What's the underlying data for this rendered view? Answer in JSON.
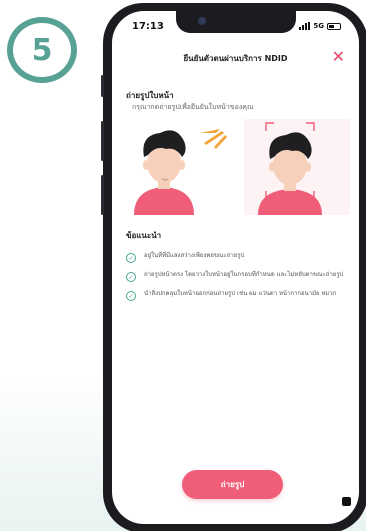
{
  "step": {
    "number": "5",
    "color": "#58a195"
  },
  "status_bar": {
    "time": "17:13",
    "network": "5G"
  },
  "header": {
    "title": "ยืนยันตัวตนผ่านบริการ NDID",
    "close_icon": "close-icon"
  },
  "photo_section": {
    "title": "ถ่ายรูปใบหน้า",
    "subtitle": "กรุณากดถ่ายรูปเพื่อยืนยันใบหน้าของคุณ"
  },
  "tips": {
    "title": "ข้อแนะนำ",
    "items": [
      "อยู่ในที่ที่มีแสงสว่างเพียงพอขณะถ่ายรูป",
      "ถ่ายรูปหน้าตรง โดยวางใบหน้าอยู่ในกรอบที่กำหนด และไม่หยับตาขณะถ่ายรูป",
      "นำสิ่งปกคลุมใบหน้าออกก่อนถ่ายรูป เช่น ผม แว่นตา หน้ากากอนามัย หมวก"
    ]
  },
  "action": {
    "label": "ถ่ายรูป"
  },
  "colors": {
    "accent": "#f05d78",
    "check": "#4aa893",
    "close": "#e0486a"
  }
}
